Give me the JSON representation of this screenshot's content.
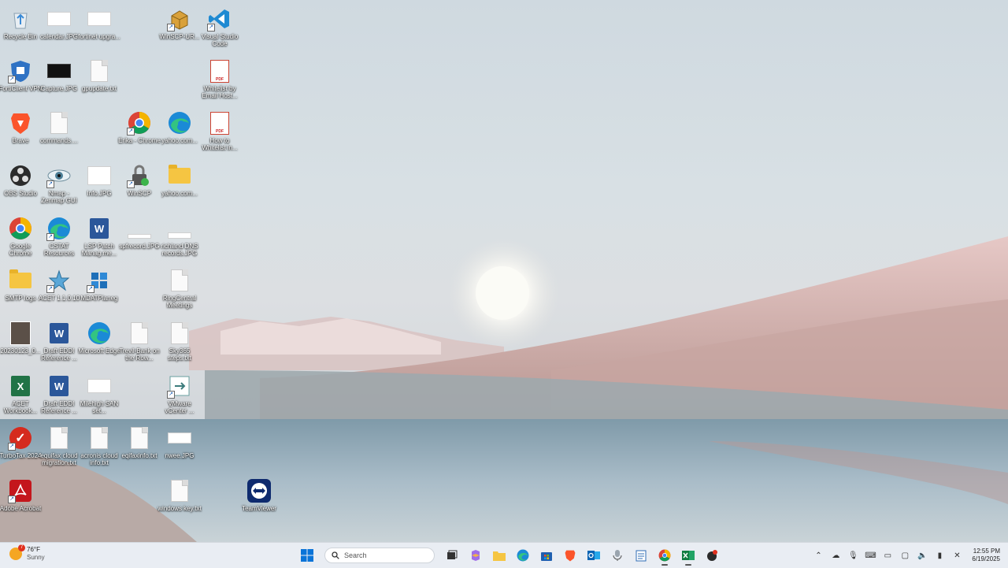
{
  "desktop_icons": [
    {
      "id": "recycle",
      "label": "Recycle Bin",
      "kind": "recycle"
    },
    {
      "id": "calendar",
      "label": "calendar.JPG",
      "kind": "thumb"
    },
    {
      "id": "fortinet",
      "label": "fortinet upgra...",
      "kind": "thumb"
    },
    {
      "id": "winscp-ur",
      "label": "WinSCP-UR...",
      "kind": "winscp"
    },
    {
      "id": "vscode",
      "label": "Visual Studio Code",
      "kind": "vscode"
    },
    {
      "id": "forticlient",
      "label": "FortiClient VPN",
      "kind": "forti"
    },
    {
      "id": "capture",
      "label": "Capture.JPG",
      "kind": "thumb-dark"
    },
    {
      "id": "gpupdate",
      "label": "gpupdate.txt",
      "kind": "doc"
    },
    {
      "id": "whitelist-email",
      "label": "Whitelist by Email Host...",
      "kind": "pdf"
    },
    {
      "id": "brave",
      "label": "Brave",
      "kind": "brave"
    },
    {
      "id": "commands",
      "label": "commands....",
      "kind": "doc"
    },
    {
      "id": "erika-chrome",
      "label": "Erika - Chrome",
      "kind": "chrome"
    },
    {
      "id": "yahoocom1",
      "label": "yahoo.com...",
      "kind": "edge"
    },
    {
      "id": "howto-whitelist",
      "label": "How to Whitelist in...",
      "kind": "pdf"
    },
    {
      "id": "obs",
      "label": "OBS Studio",
      "kind": "obs"
    },
    {
      "id": "nmap",
      "label": "Nmap - Zenmap GUI",
      "kind": "nmap"
    },
    {
      "id": "info",
      "label": "Info.JPG",
      "kind": "thumb"
    },
    {
      "id": "winscp",
      "label": "WinSCP",
      "kind": "winscp2"
    },
    {
      "id": "yahoocom2",
      "label": "yahoo.com...",
      "kind": "zip"
    },
    {
      "id": "google-chrome",
      "label": "Google Chrome",
      "kind": "chrome"
    },
    {
      "id": "cstat",
      "label": "CSTAT Resources",
      "kind": "edge"
    },
    {
      "id": "lsp-patch",
      "label": "LSP Patch Manag.me...",
      "kind": "word"
    },
    {
      "id": "spfrecord",
      "label": "spfrecord.JPG",
      "kind": "thumb"
    },
    {
      "id": "richland",
      "label": "richland DNS records.JPG",
      "kind": "thumb"
    },
    {
      "id": "smtp-logs",
      "label": "SMTP logs",
      "kind": "folder"
    },
    {
      "id": "acet",
      "label": "ACET 1.1.0.10",
      "kind": "acet"
    },
    {
      "id": "mdatp",
      "label": "MDATPlaneg",
      "kind": "mdatp"
    },
    {
      "id": "ringcentral",
      "label": "RingCentral Meetings",
      "kind": "doc"
    },
    {
      "id": "photo2023",
      "label": "20230123_0...",
      "kind": "photo"
    },
    {
      "id": "draft-eddi1",
      "label": "Draft EDDI Reference ...",
      "kind": "word"
    },
    {
      "id": "ms-edge",
      "label": "Microsoft Edge",
      "kind": "edge"
    },
    {
      "id": "trevil",
      "label": "Trevil-Bank on the Row...",
      "kind": "doc"
    },
    {
      "id": "sky365",
      "label": "Sky365 steps.txt",
      "kind": "doc"
    },
    {
      "id": "acet-workbook",
      "label": "ACET Workbook...",
      "kind": "excel"
    },
    {
      "id": "draft-eddi2",
      "label": "Draft EDDI Reference ...",
      "kind": "word"
    },
    {
      "id": "milehigh",
      "label": "Milehigh SAN set...",
      "kind": "thumb"
    },
    {
      "id": "vmware",
      "label": "VMware vCenter ...",
      "kind": "vmware"
    },
    {
      "id": "turbotax",
      "label": "TurboTax 2024",
      "kind": "turbotax"
    },
    {
      "id": "equifax-cloud",
      "label": "equifax cloud migration.txt",
      "kind": "doc"
    },
    {
      "id": "acronis",
      "label": "acronis cloud info.txt",
      "kind": "doc"
    },
    {
      "id": "eqifaxinfo",
      "label": "eqifaxinfo.txt",
      "kind": "doc"
    },
    {
      "id": "nwee",
      "label": "nwee.JPG",
      "kind": "thumb"
    },
    {
      "id": "adobe",
      "label": "Adobe Acrobat",
      "kind": "acrobat"
    },
    {
      "id": "windows-key",
      "label": "windows key.txt",
      "kind": "doc"
    },
    {
      "id": "teamviewer",
      "label": "TeamViewer",
      "kind": "teamviewer"
    }
  ],
  "taskbar": {
    "weather_temp": "76°F",
    "weather_cond": "Sunny",
    "weather_badge": "7",
    "search_placeholder": "Search",
    "clock_time": "12:55 PM",
    "clock_date": "6/19/2025"
  },
  "colors": {
    "accent": "#0067c0",
    "taskbar_bg": "#e9edf3"
  }
}
